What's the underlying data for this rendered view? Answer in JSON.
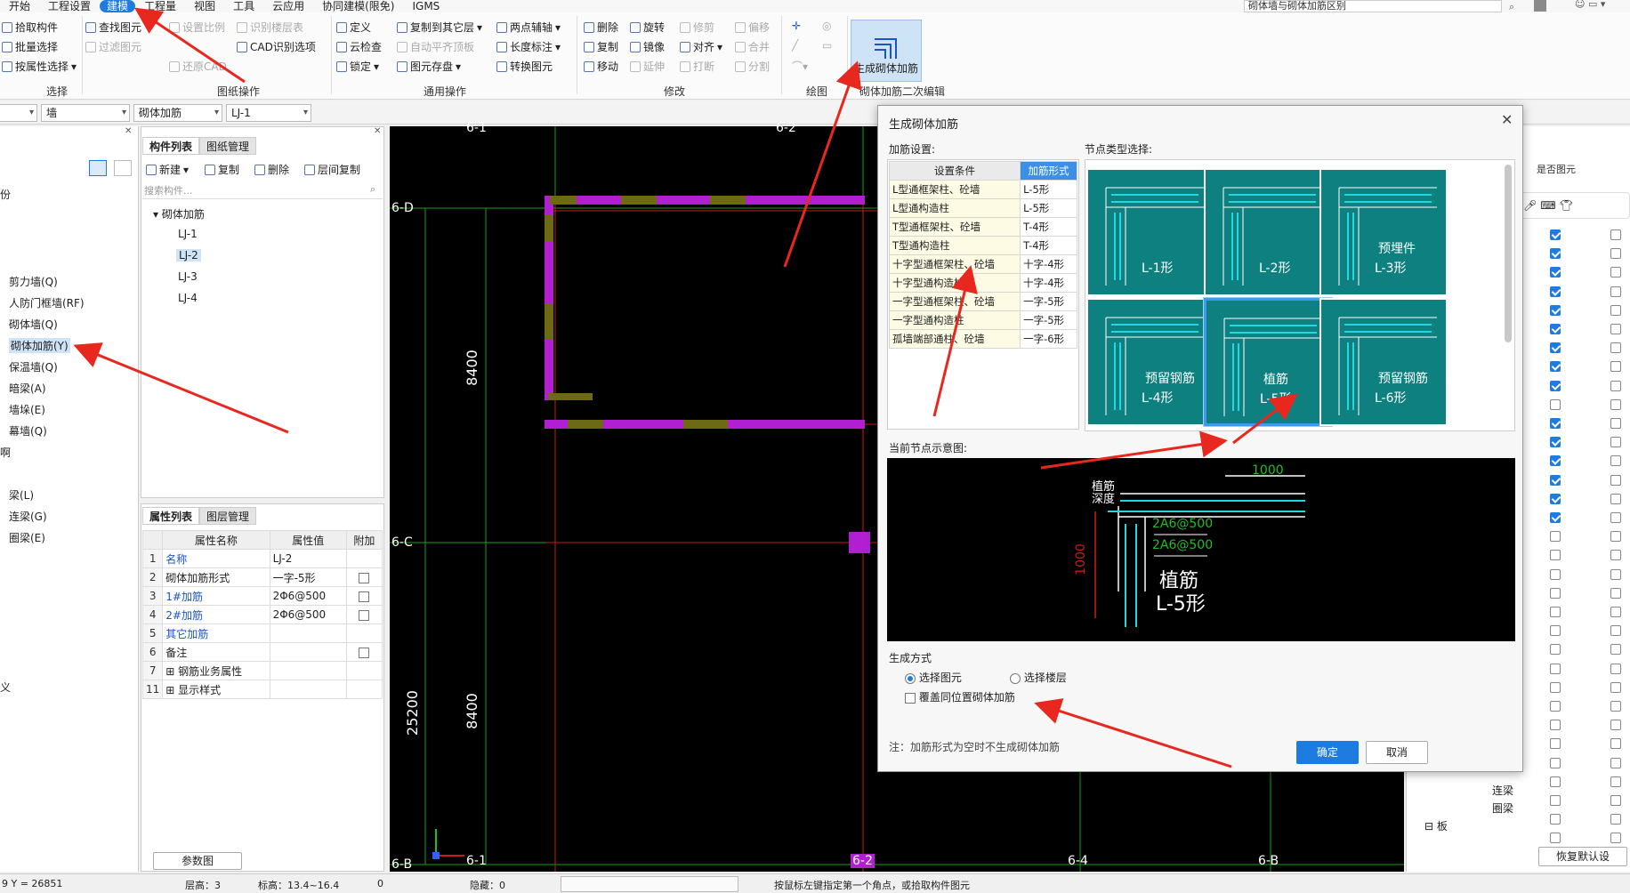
{
  "menu": [
    "开始",
    "工程设置",
    "建模",
    "工程量",
    "视图",
    "工具",
    "云应用",
    "协同建模(限免)",
    "IGMS"
  ],
  "search_text": "砌体墙与砌体加筋区别",
  "ribbon": {
    "select": {
      "items": [
        "拾取构件",
        "批量选择",
        "按属性选择"
      ],
      "label": "选择"
    },
    "drawing": {
      "items": [
        "查找图元",
        "过滤图元",
        "设置比例",
        "还原CAD",
        "识别楼层表",
        "CAD识别选项"
      ],
      "label": "图纸操作"
    },
    "general": {
      "items": [
        "定义",
        "云检查",
        "锁定",
        "复制到其它层",
        "自动平齐顶板",
        "图元存盘",
        "两点辅轴",
        "长度标注",
        "转换图元"
      ],
      "label": "通用操作"
    },
    "modify": {
      "items": [
        "删除",
        "复制",
        "移动",
        "旋转",
        "镜像",
        "延伸",
        "修剪",
        "对齐",
        "打断",
        "偏移",
        "合并",
        "分割"
      ],
      "label": "修改"
    },
    "draw_label": "绘图",
    "gen_button": "生成砌体加筋",
    "edit2_label": "砌体加筋二次编辑"
  },
  "selectors": [
    "墙",
    "砌体加筋",
    "LJ-1"
  ],
  "leftnav": [
    "剪力墙(Q)",
    "人防门框墙(RF)",
    "砌体墙(Q)",
    "砌体加筋(Y)",
    "保温墙(Q)",
    "暗梁(A)",
    "墙垛(E)",
    "幕墙(Q)",
    "梁(L)",
    "连梁(G)",
    "圈梁(E)"
  ],
  "leftnav_partial": [
    "份",
    "啊",
    "义"
  ],
  "comp": {
    "tabs": [
      "构件列表",
      "图纸管理"
    ],
    "toolbar": [
      "新建",
      "复制",
      "删除",
      "层间复制"
    ],
    "search_placeholder": "搜索构件...",
    "root": "砌体加筋",
    "items": [
      "LJ-1",
      "LJ-2",
      "LJ-3",
      "LJ-4"
    ]
  },
  "prop": {
    "tabs": [
      "属性列表",
      "图层管理"
    ],
    "headers": [
      "属性名称",
      "属性值",
      "附加"
    ],
    "rows": [
      {
        "n": "1",
        "name": "名称",
        "value": "LJ-2"
      },
      {
        "n": "2",
        "name": "砌体加筋形式",
        "value": "一字-5形"
      },
      {
        "n": "3",
        "name": "1#加筋",
        "value": "2Φ6@500"
      },
      {
        "n": "4",
        "name": "2#加筋",
        "value": "2Φ6@500"
      },
      {
        "n": "5",
        "name": "其它加筋",
        "value": ""
      },
      {
        "n": "6",
        "name": "备注",
        "value": ""
      },
      {
        "n": "7",
        "name": "钢筋业务属性",
        "value": ""
      },
      {
        "n": "11",
        "name": "显示样式",
        "value": ""
      }
    ],
    "bottom_button": "参数图"
  },
  "canvas": {
    "axis_top": [
      "6-1",
      "6-2"
    ],
    "axis_bottom": [
      "6-1",
      "6-2",
      "6-4",
      "6-B"
    ],
    "axis_left": [
      "6-D",
      "6-C",
      "6-B"
    ],
    "dims": [
      "8400",
      "8400",
      "25200"
    ]
  },
  "right": {
    "items": [
      "连梁",
      "圈梁",
      "板"
    ],
    "button": "恢复默认设",
    "header": "是否图元"
  },
  "status": {
    "coords": "9 Y = 26851",
    "floor_h": "层高：3",
    "elev": "标高：13.4~16.4",
    "zero": "0",
    "hidden": "隐藏：0",
    "hint": "按鼠标左键指定第一个角点，或拾取构件图元"
  },
  "dialog": {
    "title": "生成砌体加筋",
    "settings_label": "加筋设置:",
    "node_label": "节点类型选择:",
    "table_headers": [
      "设置条件",
      "加筋形式"
    ],
    "table_rows": [
      [
        "L型通框架柱、砼墙",
        "L-5形"
      ],
      [
        "L型通构造柱",
        "L-5形"
      ],
      [
        "T型通框架柱、砼墙",
        "T-4形"
      ],
      [
        "T型通构造柱",
        "T-4形"
      ],
      [
        "十字型通框架柱、砼墙",
        "十字-4形"
      ],
      [
        "十字型通构造柱",
        "十字-4形"
      ],
      [
        "一字型通框架柱、砼墙",
        "一字-5形"
      ],
      [
        "一字型通构造柱",
        "一字-5形"
      ],
      [
        "孤墙端部通柱、砼墙",
        "一字-6形"
      ]
    ],
    "cards": [
      {
        "label": "L-1形",
        "sub": ""
      },
      {
        "label": "L-2形",
        "sub": ""
      },
      {
        "label": "L-3形",
        "sub": "预埋件"
      },
      {
        "label": "L-4形",
        "sub": "预留钢筋"
      },
      {
        "label": "L-5形",
        "sub": "植筋"
      },
      {
        "label": "L-6形",
        "sub": "预留钢筋"
      }
    ],
    "preview_label": "当前节点示意图:",
    "preview": {
      "dim_top": "1000",
      "dim_left": "1000",
      "rebar1": "2A6@500",
      "rebar2": "2A6@500",
      "depth": "植筋深度",
      "name1": "植筋",
      "name2": "L-5形"
    },
    "gen_mode_label": "生成方式",
    "radio1": "选择图元",
    "radio2": "选择楼层",
    "overwrite": "覆盖同位置砌体加筋",
    "note": "注：加筋形式为空时不生成砌体加筋",
    "ok": "确定",
    "cancel": "取消"
  },
  "colors": {
    "accent": "#1e7be0",
    "card": "#0f8080",
    "arrow": "#e8281e",
    "wall_magenta": "#b020d0",
    "wall_olive": "#6d6a16"
  }
}
